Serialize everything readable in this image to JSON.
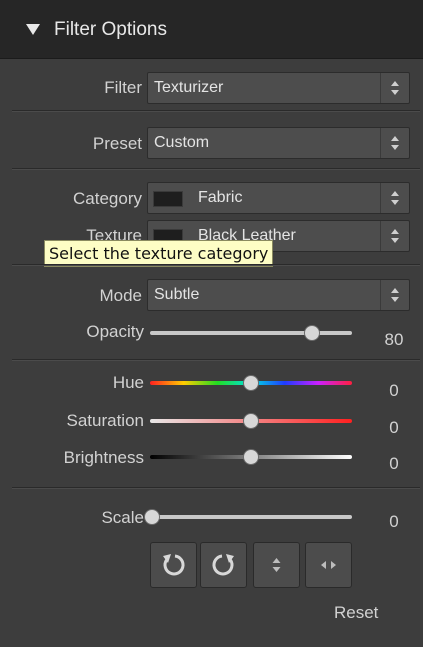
{
  "header": {
    "title": "Filter Options"
  },
  "filter": {
    "label": "Filter",
    "value": "Texturizer"
  },
  "preset": {
    "label": "Preset",
    "value": "Custom"
  },
  "category": {
    "label": "Category",
    "value": "Fabric"
  },
  "texture": {
    "label": "Texture",
    "value": "Black Leather"
  },
  "tooltip": {
    "text": "Select the texture category"
  },
  "mode": {
    "label": "Mode",
    "value": "Subtle"
  },
  "opacity": {
    "label": "Opacity",
    "value": "80",
    "level": 0.8
  },
  "hue": {
    "label": "Hue",
    "value": "0",
    "level": 0.5
  },
  "saturation": {
    "label": "Saturation",
    "value": "0",
    "level": 0.5
  },
  "brightness": {
    "label": "Brightness",
    "value": "0",
    "level": 0.5
  },
  "scale": {
    "label": "Scale",
    "value": "0",
    "level": 0.0
  },
  "tools": {
    "icons": [
      "rotate-left-icon",
      "rotate-right-icon",
      "flip-vertical-icon",
      "flip-horizontal-icon"
    ]
  },
  "reset_label": "Reset"
}
